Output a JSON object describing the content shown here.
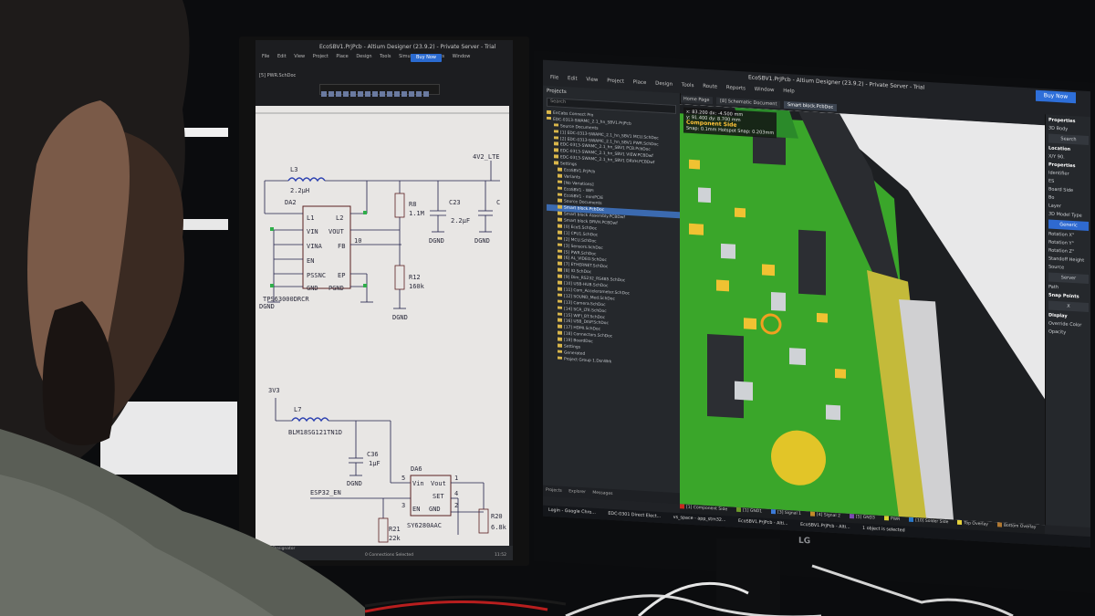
{
  "left_monitor": {
    "title": "EcoSBV1.PrjPcb - Altium Designer (23.9.2) - Private Server - Trial",
    "menu": [
      "File",
      "Edit",
      "View",
      "Project",
      "Place",
      "Design",
      "Tools",
      "Simulate",
      "Reports",
      "Window"
    ],
    "buy_now": "Buy Now",
    "document_tab": "[5] PWR.SchDoc",
    "schematic": {
      "l3_ref": "L3",
      "l3_value": "2.2µH",
      "net_top": "4V2_LTE",
      "da2_ref": "DA2",
      "da2_pins_left": [
        "L1",
        "VIN",
        "VINA",
        "EN",
        "PSSNC",
        "GND"
      ],
      "da2_pins_right": [
        "L2",
        "VOUT",
        "FB",
        "EP",
        "PGND"
      ],
      "da2_part": "TPS63000DRCR",
      "r8_ref": "R8",
      "r8_value": "1.1M",
      "c23_ref": "C23",
      "c23_value": "2.2µF",
      "r12_ref": "R12",
      "r12_value": "160k",
      "c_partial": "C",
      "pin10": "10",
      "gnd": "DGND",
      "net_3v3": "3V3",
      "l7_ref": "L7",
      "l7_part": "BLM18SG121TN1D",
      "c36_ref": "C36",
      "c36_value": "1µF",
      "da6_ref": "DA6",
      "da6_pins": [
        "Vin",
        "Vout",
        "SET",
        "EN",
        "GND"
      ],
      "da6_part": "SY6280AAC",
      "da6_pin_nums": [
        "5",
        "1",
        "4",
        "3",
        "2"
      ],
      "net_esp": "ESP32_EN",
      "r21_ref": "R21",
      "r21_value": "22k",
      "r20_ref": "R20",
      "r20_value": "6.8k"
    },
    "status": {
      "tabs": "Editor   Designator",
      "bottom": "0 Connections Selected",
      "time": "11:52"
    }
  },
  "right_monitor": {
    "title": "EcoSBV1.PrjPcb - Altium Designer (23.9.2) - Private Server - Trial",
    "buy_now": "Buy Now",
    "menu": [
      "File",
      "Edit",
      "View",
      "Project",
      "Place",
      "Design",
      "Tools",
      "Route",
      "Reports",
      "Window",
      "Help"
    ],
    "tabs": [
      "Home Page",
      "[8] Schematic Document",
      "Smart block.PcbDoc"
    ],
    "projects_header": "Projects",
    "search_placeholder": "Search",
    "tree": [
      "EnCabs Connect Pro",
      "EDC-0313-SWAMC_2.1_hn_SBV1.PrjPcb",
      "Source Documents",
      "[1] EDC-0313-SWAMC_2.1_hn_SBV1 MCU.SchDoc",
      "[2] EDC-0313-SWAMC_2.1_hn_SBV1 PWR.SchDoc",
      "EDC-0313-SWAMC_2.1_hn_SBV1 PCB.PcbDoc",
      "EDC-0313-SWAMC_2.1_hn_SBV1 VIEW.PCBDwf",
      "EDC-0313-SWAMC_2.1_hn_SBV1 DRVH.PCBDwf",
      "Settings",
      "EcoSBV1.PrjPcb",
      "Variants",
      "[No Variations]",
      "EcoSBV1 - WiFi",
      "EcoSBV1 - miniPCIE",
      "Source Documents",
      "Smart block.PcbDoc",
      "Smart block Assembly.PCBDwf",
      "Smart block DRVH.PCBDwf",
      "[0] EcoS.SchDoc",
      "[1] CPU1.SchDoc",
      "[2] MCU.SchDoc",
      "[3] Sensors.SchDoc",
      "[5] PWR.SchDoc",
      "[6] AL_VIDEO.SchDoc",
      "[7] ETHERNET.SchDoc",
      "[8] IO.SchDoc",
      "[9] Dim_RS232_RS485.SchDoc",
      "[10] USB-HUB.SchDoc",
      "[11] Com_Accelerometer.SchDoc",
      "[12] SOUND_Med.SchDoc",
      "[13] Camera.SchDoc",
      "[14] SCA_LTE.SchDoc",
      "[15] WIFI_BT.SchDoc",
      "[16] USB_DISP.SchDoc",
      "[17] HDMI.SchDoc",
      "[18] Connectors.SchDoc",
      "[19] BoardDoc",
      "Settings",
      "Generated",
      "Project Group 1.DsnWrk"
    ],
    "tree_selected_index": 15,
    "proj_tabs": [
      "Projects",
      "Explorer",
      "Messages"
    ],
    "coords": {
      "x": "x: 83.200",
      "dx": "dx: -4.500 mm",
      "y": "y: 91.400",
      "dy": "dy: 8.700 mm",
      "side": "Component Side",
      "snap": "Snap: 0.1mm Hotspot Snap: 0.203mm"
    },
    "properties": {
      "header": "Properties",
      "body": "3D Body",
      "search": "Search",
      "location": "Location",
      "xy": "X/Y",
      "xy_val": "90.",
      "props_sec": "Properties",
      "identifier": "Identifier",
      "identifier_val": "ES",
      "board_side": "Board Side",
      "board_side_val": "Bo",
      "layer": "Layer",
      "model_type": "3D Model Type",
      "generic": "Generic",
      "rot_x": "Rotation X°",
      "rot_y": "Rotation Y°",
      "rot_z": "Rotation Z°",
      "standoff": "Standoff Height",
      "source": "Source",
      "server": "Server",
      "path": "Path",
      "snap_points": "Snap Points",
      "x_label": "X",
      "display": "Display",
      "override": "Override Color",
      "opacity": "Opacity"
    },
    "layers": [
      "[1] Component Side",
      "[1] GND1",
      "[3] Signal 1",
      "[4] Signal 2",
      "[5] GND3",
      "PWR",
      "[10] Solder Side",
      "Top Overlay",
      "Bottom Overlay"
    ],
    "layer_colors": [
      "#c8281e",
      "#6b9a2a",
      "#3b7ad6",
      "#c38a2a",
      "#7d4ab0",
      "#d6d232",
      "#2a78c8",
      "#e6d23c",
      "#b07830"
    ],
    "status_left": "0 Connections Selected",
    "status_right": "1 object is selected",
    "taskbar": [
      "Login - Google Chro...",
      "EDC-0301 Direct Elect...",
      "vs_space - app_stm32...",
      "EcoSBV1.PrjPcb - Alti...",
      "EcoSBV1.PrjPcb - Alti..."
    ],
    "brand": "LG"
  },
  "colors": {
    "pcb_green": "#3fae2a",
    "altium_dark": "#25282c",
    "accent_blue": "#2e6fd9",
    "component_yellow": "#f2c02a"
  }
}
